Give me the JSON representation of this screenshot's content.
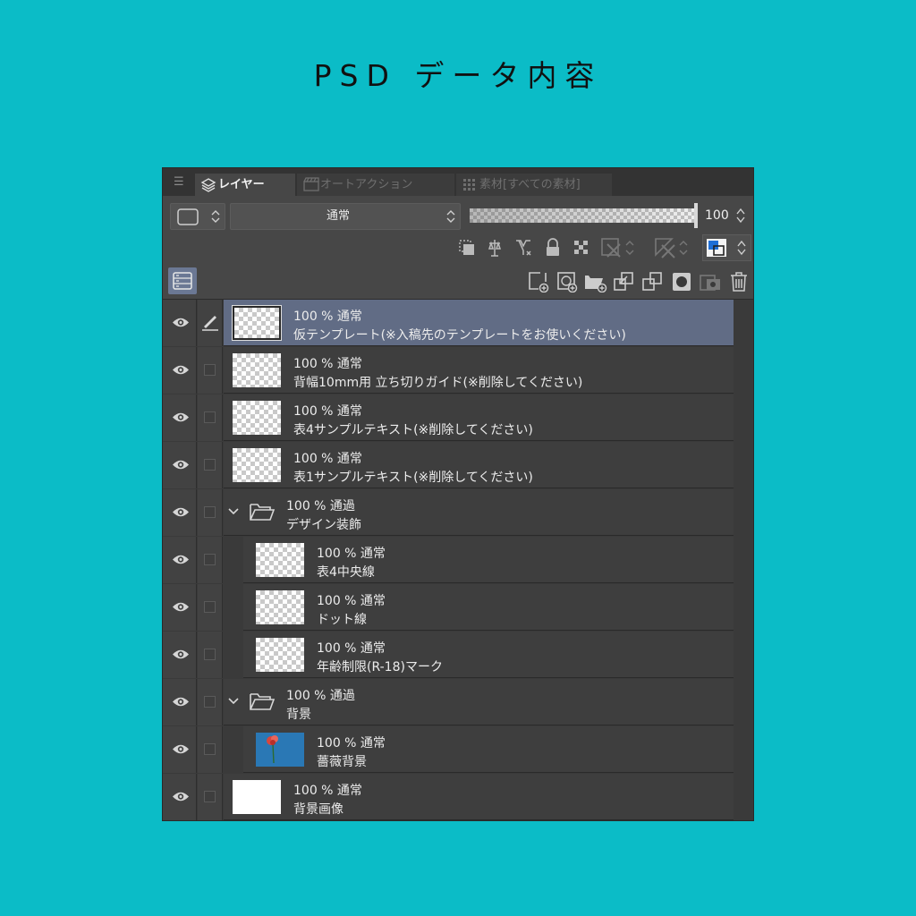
{
  "title": "PSD データ内容",
  "tabs": [
    {
      "label": "レイヤー",
      "icon": "layers-icon",
      "active": true
    },
    {
      "label": "オートアクション",
      "icon": "clapperboard-icon",
      "active": false
    },
    {
      "label": "素材[すべての素材]",
      "icon": "grid-icon",
      "active": false
    }
  ],
  "toolbar": {
    "blend_mode": "通常",
    "opacity": "100",
    "opacity_fraction": 1.0
  },
  "layers": [
    {
      "props": "100 % 通常",
      "name": "仮テンプレート(※入稿先のテンプレートをお使いください)",
      "type": "layer",
      "indent": 0,
      "selected": true,
      "thumb": "checker",
      "editing": true
    },
    {
      "props": "100 % 通常",
      "name": "背幅10mm用 立ち切りガイド(※削除してください)",
      "type": "layer",
      "indent": 0,
      "selected": false,
      "thumb": "checker"
    },
    {
      "props": "100 % 通常",
      "name": "表4サンプルテキスト(※削除してください)",
      "type": "layer",
      "indent": 0,
      "selected": false,
      "thumb": "checker"
    },
    {
      "props": "100 % 通常",
      "name": "表1サンプルテキスト(※削除してください)",
      "type": "layer",
      "indent": 0,
      "selected": false,
      "thumb": "checker"
    },
    {
      "props": "100 % 通過",
      "name": "デザイン装飾",
      "type": "folder",
      "indent": 0,
      "selected": false
    },
    {
      "props": "100 % 通常",
      "name": "表4中央線",
      "type": "layer",
      "indent": 1,
      "selected": false,
      "thumb": "checker"
    },
    {
      "props": "100 % 通常",
      "name": "ドット線",
      "type": "layer",
      "indent": 1,
      "selected": false,
      "thumb": "checker"
    },
    {
      "props": "100 % 通常",
      "name": "年齢制限(R-18)マーク",
      "type": "layer",
      "indent": 1,
      "selected": false,
      "thumb": "checker"
    },
    {
      "props": "100 % 通過",
      "name": "背景",
      "type": "folder",
      "indent": 0,
      "selected": false
    },
    {
      "props": "100 % 通常",
      "name": "薔薇背景",
      "type": "layer",
      "indent": 1,
      "selected": false,
      "thumb": "rose"
    },
    {
      "props": "100 % 通常",
      "name": "背景画像",
      "type": "layer",
      "indent": 0,
      "selected": false,
      "thumb": "white"
    }
  ]
}
